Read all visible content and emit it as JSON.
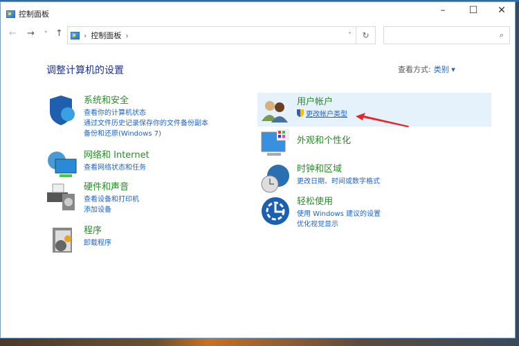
{
  "window": {
    "title": "控制面板",
    "minimize": "–",
    "maximize": "☐",
    "close": "✕"
  },
  "nav": {
    "back": "←",
    "forward": "→",
    "recent": "˅",
    "up": "↑"
  },
  "address": {
    "crumb": "控制面板",
    "sep": "›",
    "dropdown": "˅",
    "refresh": "↻"
  },
  "search": {
    "placeholder": "",
    "icon": "⌕"
  },
  "heading": "调整计算机的设置",
  "view": {
    "label": "查看方式:",
    "value": "类别",
    "caret": "▾"
  },
  "categories": [
    {
      "title": "系统和安全",
      "links": [
        "查看你的计算机状态",
        "通过文件历史记录保存你的文件备份副本",
        "备份和还原(Windows 7)"
      ]
    },
    {
      "title": "网络和 Internet",
      "links": [
        "查看网络状态和任务"
      ]
    },
    {
      "title": "硬件和声音",
      "links": [
        "查看设备和打印机",
        "添加设备"
      ]
    },
    {
      "title": "程序",
      "links": [
        "卸载程序"
      ]
    },
    {
      "title": "用户帐户",
      "links": [
        "更改帐户类型"
      ]
    },
    {
      "title": "外观和个性化",
      "links": []
    },
    {
      "title": "时钟和区域",
      "links": [
        "更改日期、时间或数字格式"
      ]
    },
    {
      "title": "轻松使用",
      "links": [
        "使用 Windows 建议的设置",
        "优化视觉显示"
      ]
    }
  ],
  "colors": {
    "link": "#1c64c8",
    "category": "#2a8a2a",
    "heading": "#1e3287",
    "highlight": "#e5f1fb",
    "arrow": "#e8262a"
  }
}
